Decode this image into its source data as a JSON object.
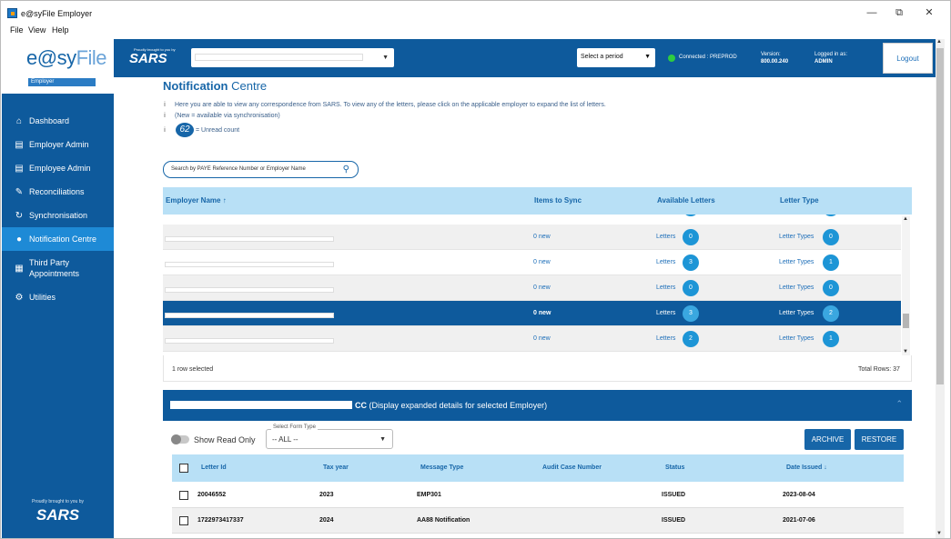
{
  "window": {
    "title": "e@syFile Employer",
    "minimize": "—",
    "restore": "⧉",
    "close": "✕"
  },
  "menu": [
    "File",
    "View",
    "Help"
  ],
  "brand": {
    "logo_a": "e@sy",
    "logo_b": "File",
    "badge": "Employer"
  },
  "sidebar": {
    "items": [
      {
        "label": "Dashboard",
        "icon": "home-icon",
        "glyph": "⌂"
      },
      {
        "label": "Employer Admin",
        "icon": "id-card-icon",
        "glyph": "▤"
      },
      {
        "label": "Employee Admin",
        "icon": "id-card-icon",
        "glyph": "▤"
      },
      {
        "label": "Reconciliations",
        "icon": "edit-document-icon",
        "glyph": "✎"
      },
      {
        "label": "Synchronisation",
        "icon": "sync-icon",
        "glyph": "↻"
      },
      {
        "label": "Notification Centre",
        "icon": "notification-icon",
        "glyph": "●"
      },
      {
        "label": "Third Party Appointments",
        "icon": "calendar-icon",
        "glyph": "▦"
      },
      {
        "label": "Utilities",
        "icon": "gears-icon",
        "glyph": "⚙"
      }
    ],
    "active_index": 5,
    "footer_small": "Proudly brought to you by",
    "footer_logo": "SARS"
  },
  "topbar": {
    "sars_small": "Proudly brought to you by",
    "sars_logo": "SARS",
    "period_label": "Select a period",
    "connection": "Connected : PREPROD",
    "version_label": "Version:",
    "version_value": "800.00.240",
    "user_label": "Logged in as:",
    "user_value": "ADMIN",
    "logout": "Logout"
  },
  "page": {
    "title_bold": "Notification",
    "title_rest": " Centre",
    "info1": "Here you are able to view any correspondence from SARS. To view any of the letters, please click on the applicable employer to expand the list of letters.",
    "info2": "(New = available via synchronisation)",
    "unread_count": "62",
    "unread_label": "= Unread count",
    "search_placeholder": "Search by PAYE Reference Number or Employer Name"
  },
  "employer_grid": {
    "columns": [
      "Employer Name ↑",
      "Items to Sync",
      "Available Letters",
      "Letter Type"
    ],
    "letters_label": "Letters",
    "types_label": "Letter Types",
    "rows": [
      {
        "sync": "0 new",
        "letters": "0",
        "types": "0",
        "selected": false
      },
      {
        "sync": "0 new",
        "letters": "3",
        "types": "1",
        "selected": false
      },
      {
        "sync": "0 new",
        "letters": "0",
        "types": "0",
        "selected": false
      },
      {
        "sync": "0 new",
        "letters": "3",
        "types": "2",
        "selected": true
      },
      {
        "sync": "0 new",
        "letters": "2",
        "types": "1",
        "selected": false
      }
    ],
    "selected_text": "1 row selected",
    "total_text": "Total Rows: 37"
  },
  "expanded": {
    "title_bold": "CC",
    "title_rest": " (Display expanded details for selected Employer)",
    "show_read_only": "Show Read Only",
    "form_type_label": "Select Form Type",
    "form_type_value": "-- ALL --",
    "archive": "ARCHIVE",
    "restore": "RESTORE"
  },
  "letters_grid": {
    "columns": [
      "Letter Id",
      "Tax year",
      "Message Type",
      "Audit Case Number",
      "Status",
      "Date Issued ↓"
    ],
    "rows": [
      {
        "id": "20046552",
        "year": "2023",
        "type": "EMP301",
        "audit": "",
        "status": "ISSUED",
        "date": "2023-08-04"
      },
      {
        "id": "1722973417337",
        "year": "2024",
        "type": "AA88 Notification",
        "audit": "",
        "status": "ISSUED",
        "date": "2021-07-06"
      }
    ]
  },
  "colors": {
    "brand": "#0e5a9c",
    "accent": "#1d95d6",
    "header_bg": "#b8e0f6",
    "connected": "#2ecc40"
  }
}
